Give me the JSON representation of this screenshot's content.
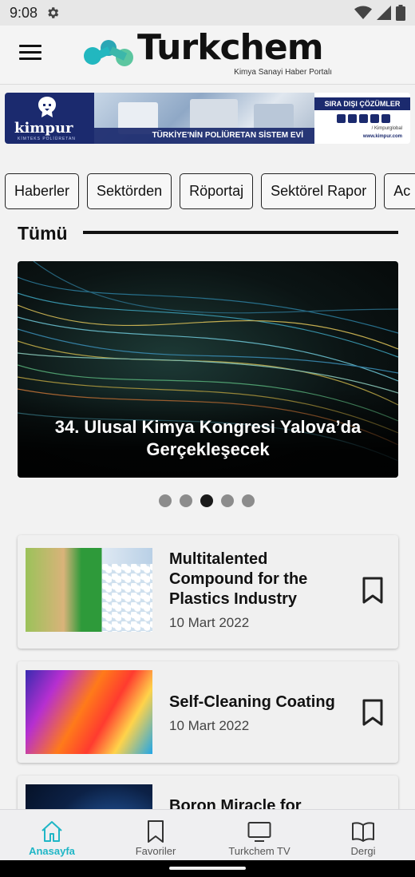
{
  "status_bar": {
    "time": "9:08"
  },
  "header": {
    "logo_text": "Turkchem",
    "logo_subtitle": "Kimya Sanayi Haber Portalı",
    "brand_colors": {
      "logo_teal": "#22b7bf",
      "logo_green": "#5cc6a0"
    }
  },
  "banner": {
    "brand": "kimpur",
    "brand_sub": "KİMTEKS POLİÜRETAN",
    "tagline": "TÜRKİYE'NİN POLİÜRETAN SİSTEM EVİ",
    "ribbon": "SIRA DIŞI ÇÖZÜMLER",
    "handle": "/ Kimpurglobal",
    "url": "www.kimpur.com"
  },
  "tabs": [
    "Haberler",
    "Sektörden",
    "Röportaj",
    "Sektörel Rapor",
    "Ac"
  ],
  "section": {
    "title": "Tümü"
  },
  "hero": {
    "title": "34. Ulusal Kimya Kongresi Yalova’da Gerçekleşecek",
    "dots_total": 5,
    "active_dot": 3
  },
  "cards": [
    {
      "title": "Multitalented Compound for the Plastics Industry",
      "date": "10 Mart 2022"
    },
    {
      "title": "Self-Cleaning Coating",
      "date": "10 Mart 2022"
    },
    {
      "title": "Boron Miracle for",
      "date": ""
    }
  ],
  "bottom_nav": [
    {
      "label": "Anasayfa",
      "icon": "home-icon",
      "active": true
    },
    {
      "label": "Favoriler",
      "icon": "bookmark-icon",
      "active": false
    },
    {
      "label": "Turkchem TV",
      "icon": "tv-icon",
      "active": false
    },
    {
      "label": "Dergi",
      "icon": "book-icon",
      "active": false
    }
  ],
  "colors": {
    "accent": "#1fb6c6",
    "active_dot": "#1a1a1a",
    "inactive_dot": "#8c8c8c"
  }
}
